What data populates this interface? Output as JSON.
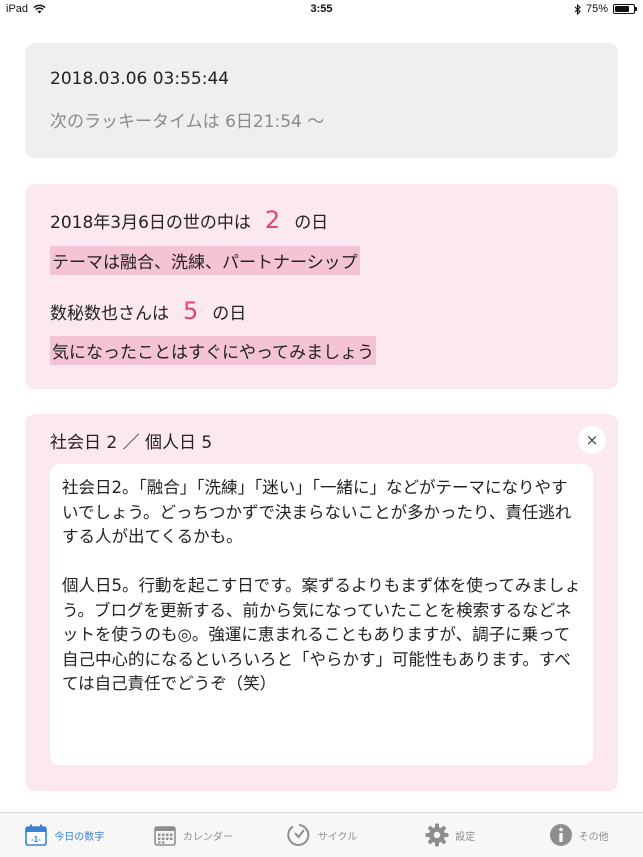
{
  "status_bar": {
    "device": "iPad",
    "time": "3:55",
    "battery": "75%",
    "battery_level": 0.75
  },
  "date_card": {
    "timestamp": "2018.03.06 03:55:44",
    "lucky_time": "次のラッキータイムは 6日21:54 〜"
  },
  "today_card": {
    "world_prefix": "2018年3月6日の世の中は",
    "world_number": "2",
    "world_suffix": "の日",
    "world_theme": "テーマは融合、洗練、パートナーシップ",
    "personal_prefix": "数秘数也さんは",
    "personal_number": "5",
    "personal_suffix": "の日",
    "personal_advice": "気になったことはすぐにやってみましょう"
  },
  "detail_card": {
    "title": "社会日 2 ／ 個人日 5",
    "close_label": "×",
    "paragraph1": "社会日2。「融合」「洗練」「迷い」「一緒に」などがテーマになりやすいでしょう。どっちつかずで決まらないことが多かったり、責任逃れする人が出てくるかも。",
    "paragraph2": "個人日5。行動を起こす日です。案ずるよりもまず体を使ってみましょう。ブログを更新する、前から気になっていたことを検索するなどネットを使うのも◎。強運に恵まれることもありますが、調子に乗って自己中心的になるといろいろと「やらかす」可能性もあります。すべては自己責任でどうぞ（笑）"
  },
  "tabs": [
    {
      "label": "今日の数字",
      "icon": "calendar-today-icon",
      "icon_text": "-1-",
      "active": true
    },
    {
      "label": "カレンダー",
      "icon": "calendar-grid-icon",
      "active": false
    },
    {
      "label": "サイクル",
      "icon": "cycle-icon",
      "active": false
    },
    {
      "label": "設定",
      "icon": "gear-icon",
      "active": false
    },
    {
      "label": "その他",
      "icon": "info-icon",
      "active": false
    }
  ],
  "colors": {
    "accent": "#e0457b",
    "highlight": "#f5c3d6",
    "card_pink": "#fbe9ef",
    "tab_active": "#3b82d6"
  }
}
